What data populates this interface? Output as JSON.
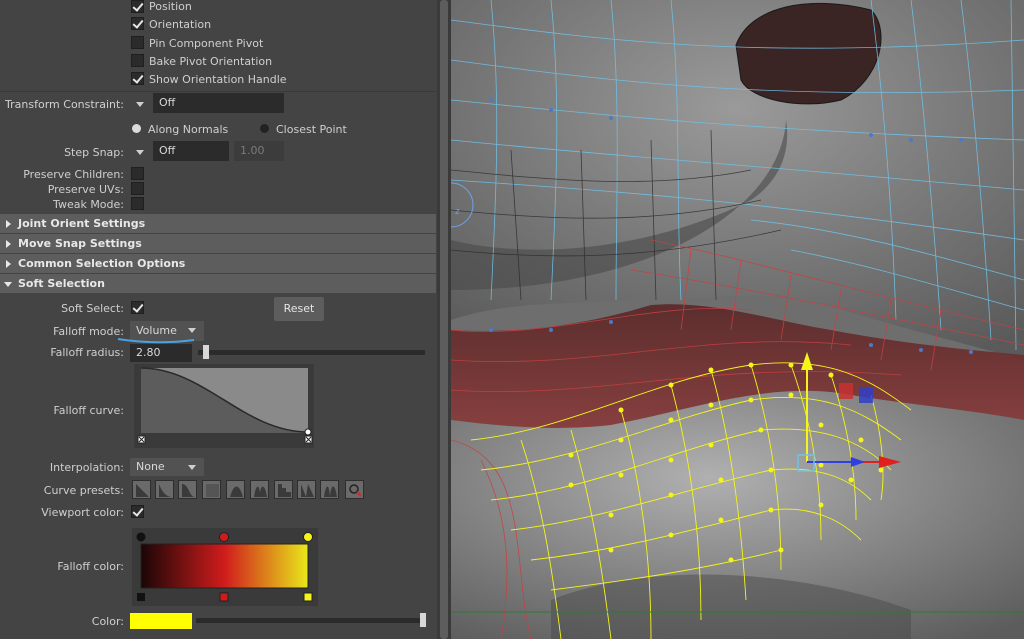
{
  "checkboxes": {
    "position": {
      "label": "Position",
      "checked": true
    },
    "orientation": {
      "label": "Orientation",
      "checked": true
    },
    "pin_component_pivot": {
      "label": "Pin Component Pivot",
      "checked": false
    },
    "bake_pivot_orientation": {
      "label": "Bake Pivot Orientation",
      "checked": false
    },
    "show_orientation_handle": {
      "label": "Show Orientation Handle",
      "checked": true
    }
  },
  "transform_constraint": {
    "label": "Transform Constraint:",
    "value": "Off"
  },
  "constraint_options": {
    "along_normals": "Along Normals",
    "closest_point": "Closest Point"
  },
  "step_snap": {
    "label": "Step Snap:",
    "value": "Off",
    "amount": "1.00"
  },
  "preserve_children": {
    "label": "Preserve Children:"
  },
  "preserve_uvs": {
    "label": "Preserve UVs:"
  },
  "tweak_mode": {
    "label": "Tweak Mode:"
  },
  "sections": {
    "joint_orient": "Joint Orient Settings",
    "move_snap": "Move Snap Settings",
    "common_selection": "Common Selection Options",
    "soft_selection": "Soft Selection"
  },
  "soft_selection": {
    "soft_select_label": "Soft Select:",
    "reset_label": "Reset",
    "falloff_mode_label": "Falloff mode:",
    "falloff_mode_value": "Volume",
    "falloff_radius_label": "Falloff radius:",
    "falloff_radius_value": "2.80",
    "falloff_curve_label": "Falloff curve:",
    "interpolation_label": "Interpolation:",
    "interpolation_value": "None",
    "curve_presets_label": "Curve presets:",
    "viewport_color_label": "Viewport color:",
    "falloff_color_label": "Falloff color:",
    "color_label": "Color:",
    "color_value": "#ffff00"
  },
  "colors": {
    "accent_underline": "#4aa3df",
    "selection_yellow": "#f5f51a",
    "falloff_red": "#8a2020",
    "wire_blue": "#6fc3e8"
  }
}
